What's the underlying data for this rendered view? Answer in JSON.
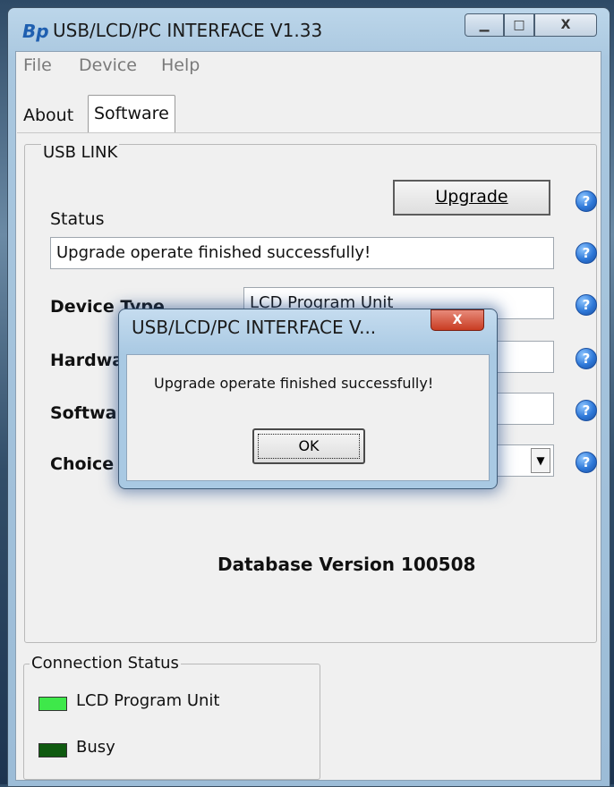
{
  "window": {
    "title": "USB/LCD/PC INTERFACE V1.33",
    "app_icon": "Bp",
    "controls": {
      "minimize": "▁",
      "maximize": "□",
      "close": "X"
    }
  },
  "menu": [
    "File",
    "Device",
    "Help"
  ],
  "tabs": [
    {
      "label": "About",
      "active": false
    },
    {
      "label": "Software",
      "active": true
    }
  ],
  "usb_link": {
    "group_title": "USB LINK",
    "status_label": "Status",
    "upgrade_button": "Upgrade",
    "status_value": "Upgrade operate finished successfully!",
    "device_type_label": "Device Type",
    "device_type_value": "LCD Program Unit",
    "hardware_label": "Hardwa",
    "software_label": "Softwa",
    "choice_label": "Choice",
    "help_icon": "?",
    "database_version": "Database Version 100508"
  },
  "connection_status": {
    "title": "Connection Status",
    "items": [
      {
        "label": "LCD Program Unit",
        "color": "#3ee84a"
      },
      {
        "label": "Busy",
        "color": "#0f5a10"
      }
    ]
  },
  "dialog": {
    "title": "USB/LCD/PC INTERFACE V...",
    "message": "Upgrade operate finished successfully!",
    "ok": "OK",
    "close": "X"
  }
}
